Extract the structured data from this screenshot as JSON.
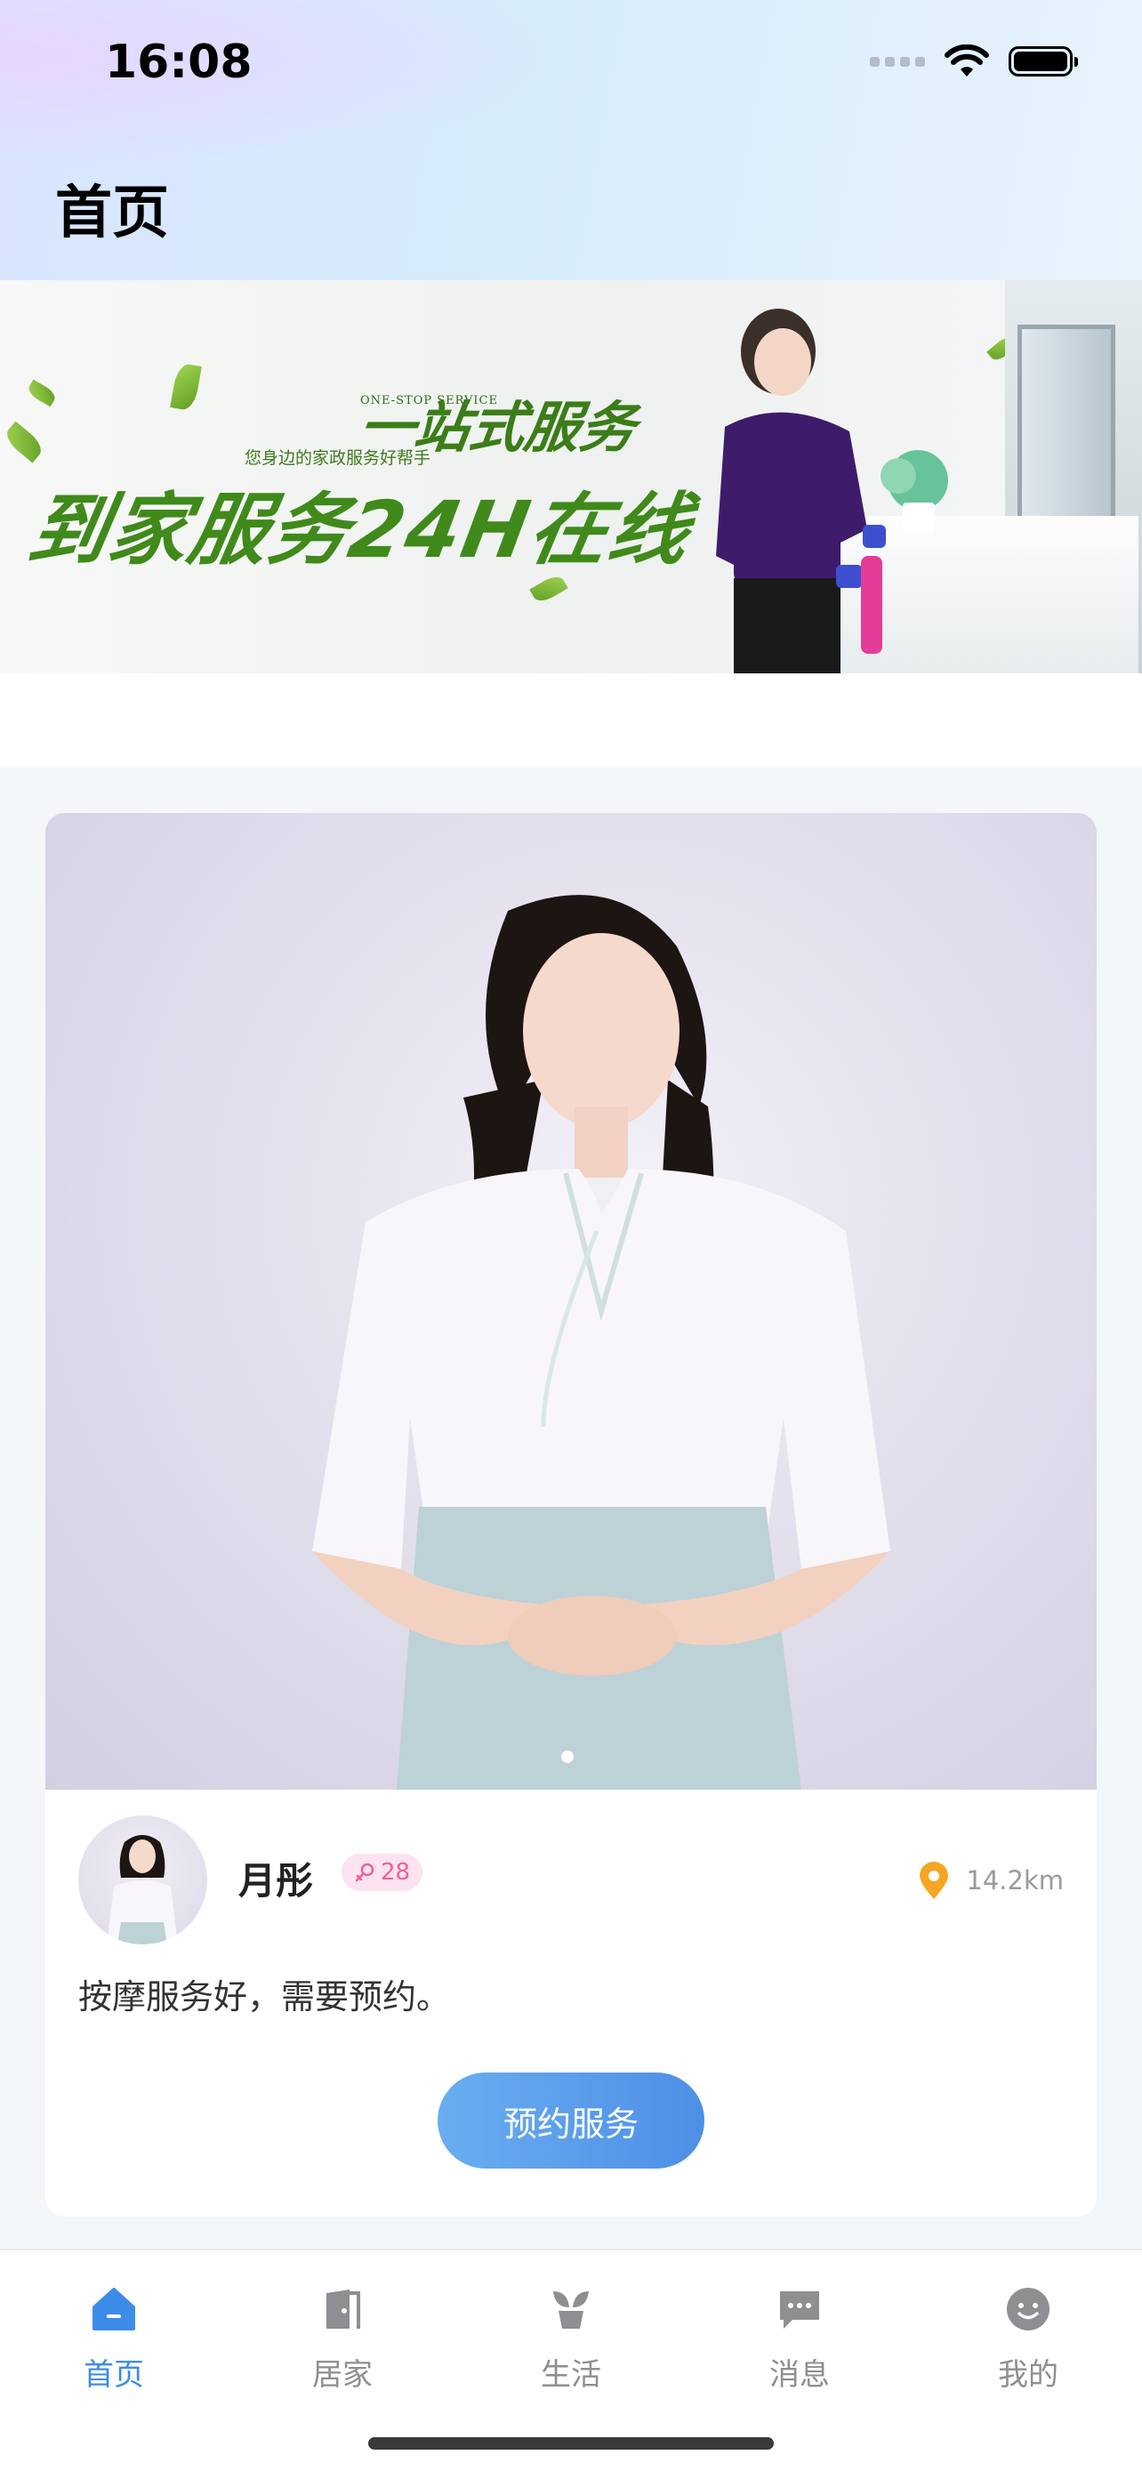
{
  "status_bar": {
    "time": "16:08"
  },
  "header": {
    "title": "首页"
  },
  "banner": {
    "subtitle_en": "ONE-STOP SERVICE",
    "subtitle_cn": "您身边的家政服务好帮手",
    "tagline": "一站式服务",
    "headline": "到家服务24H在线"
  },
  "card": {
    "name": "月彤",
    "age": "28",
    "distance": "14.2km",
    "description": "按摩服务好，需要预约。",
    "book_button": "预约服务",
    "carousel_page": 1,
    "carousel_pages": 1
  },
  "tabbar": {
    "items": [
      {
        "label": "首页",
        "icon": "home-icon",
        "active": true
      },
      {
        "label": "居家",
        "icon": "door-icon",
        "active": false
      },
      {
        "label": "生活",
        "icon": "sprout-icon",
        "active": false
      },
      {
        "label": "消息",
        "icon": "message-icon",
        "active": false
      },
      {
        "label": "我的",
        "icon": "smiley-icon",
        "active": false
      }
    ]
  },
  "colors": {
    "accent": "#3d8ce8",
    "badge_bg": "#fde3ef",
    "badge_text": "#ef5f9b",
    "banner_green": "#3f8a1a",
    "inactive_tab": "#8e8e93"
  }
}
